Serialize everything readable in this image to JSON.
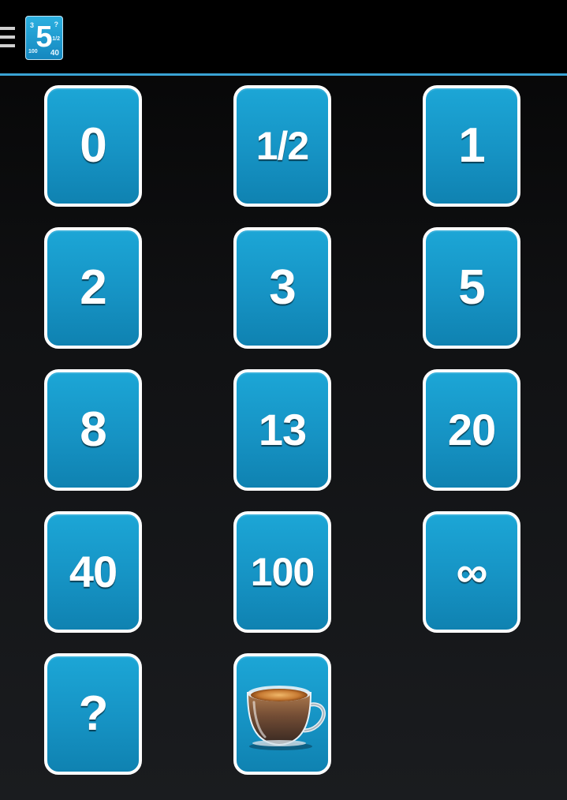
{
  "header": {
    "menu_icon": "hamburger-icon",
    "logo": {
      "main_digit": "5",
      "corner_values": [
        "3",
        "?",
        "1/2",
        "100",
        "40"
      ]
    },
    "accent_color": "#3aa3d4"
  },
  "cards": [
    {
      "label": "0"
    },
    {
      "label": "1/2"
    },
    {
      "label": "1"
    },
    {
      "label": "2"
    },
    {
      "label": "3"
    },
    {
      "label": "5"
    },
    {
      "label": "8"
    },
    {
      "label": "13"
    },
    {
      "label": "20"
    },
    {
      "label": "40"
    },
    {
      "label": "100"
    },
    {
      "label": "∞"
    },
    {
      "label": "?"
    },
    {
      "icon": "coffee-cup-icon"
    }
  ],
  "colors": {
    "card_blue": "#1693c4",
    "card_border": "#ffffff"
  }
}
